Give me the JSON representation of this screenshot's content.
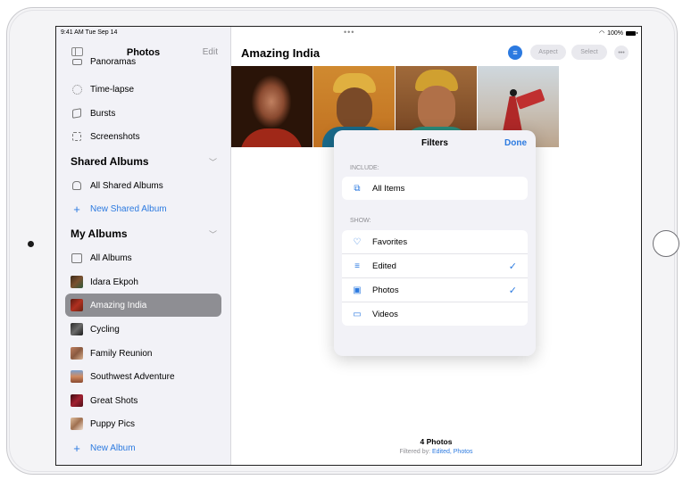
{
  "status_bar": {
    "time": "9:41 AM  Tue Sep 14",
    "dots": "•••",
    "battery": "100%"
  },
  "sidebar": {
    "title": "Photos",
    "edit": "Edit",
    "items": [
      {
        "label": "Panoramas",
        "icon": "panorama-icon"
      },
      {
        "label": "Time-lapse",
        "icon": "timelapse-icon"
      },
      {
        "label": "Bursts",
        "icon": "bursts-icon"
      },
      {
        "label": "Screenshots",
        "icon": "screenshot-icon"
      }
    ],
    "shared_albums": {
      "heading": "Shared Albums",
      "items": [
        {
          "label": "All Shared Albums"
        },
        {
          "label": "New Shared Album"
        }
      ]
    },
    "my_albums": {
      "heading": "My Albums",
      "items": [
        {
          "label": "All Albums"
        },
        {
          "label": "Idara Ekpoh"
        },
        {
          "label": "Amazing India"
        },
        {
          "label": "Cycling"
        },
        {
          "label": "Family Reunion"
        },
        {
          "label": "Southwest Adventure"
        },
        {
          "label": "Great Shots"
        },
        {
          "label": "Puppy Pics"
        },
        {
          "label": "New Album"
        }
      ]
    }
  },
  "main": {
    "title": "Amazing India",
    "aspect": "Aspect",
    "select": "Select",
    "more": "•••",
    "footer": {
      "count": "4 Photos",
      "filtered_prefix": "Filtered by: ",
      "filtered_values": "Edited, Photos"
    }
  },
  "filters": {
    "title": "Filters",
    "done": "Done",
    "include_label": "INCLUDE:",
    "include_items": [
      {
        "label": "All Items"
      }
    ],
    "show_label": "SHOW:",
    "show_items": [
      {
        "label": "Favorites",
        "checked": false
      },
      {
        "label": "Edited",
        "checked": true
      },
      {
        "label": "Photos",
        "checked": true
      },
      {
        "label": "Videos",
        "checked": false
      }
    ],
    "checkmark": "✓"
  },
  "colors": {
    "accent": "#2c7ae0",
    "selected_row": "#8e8e93"
  }
}
